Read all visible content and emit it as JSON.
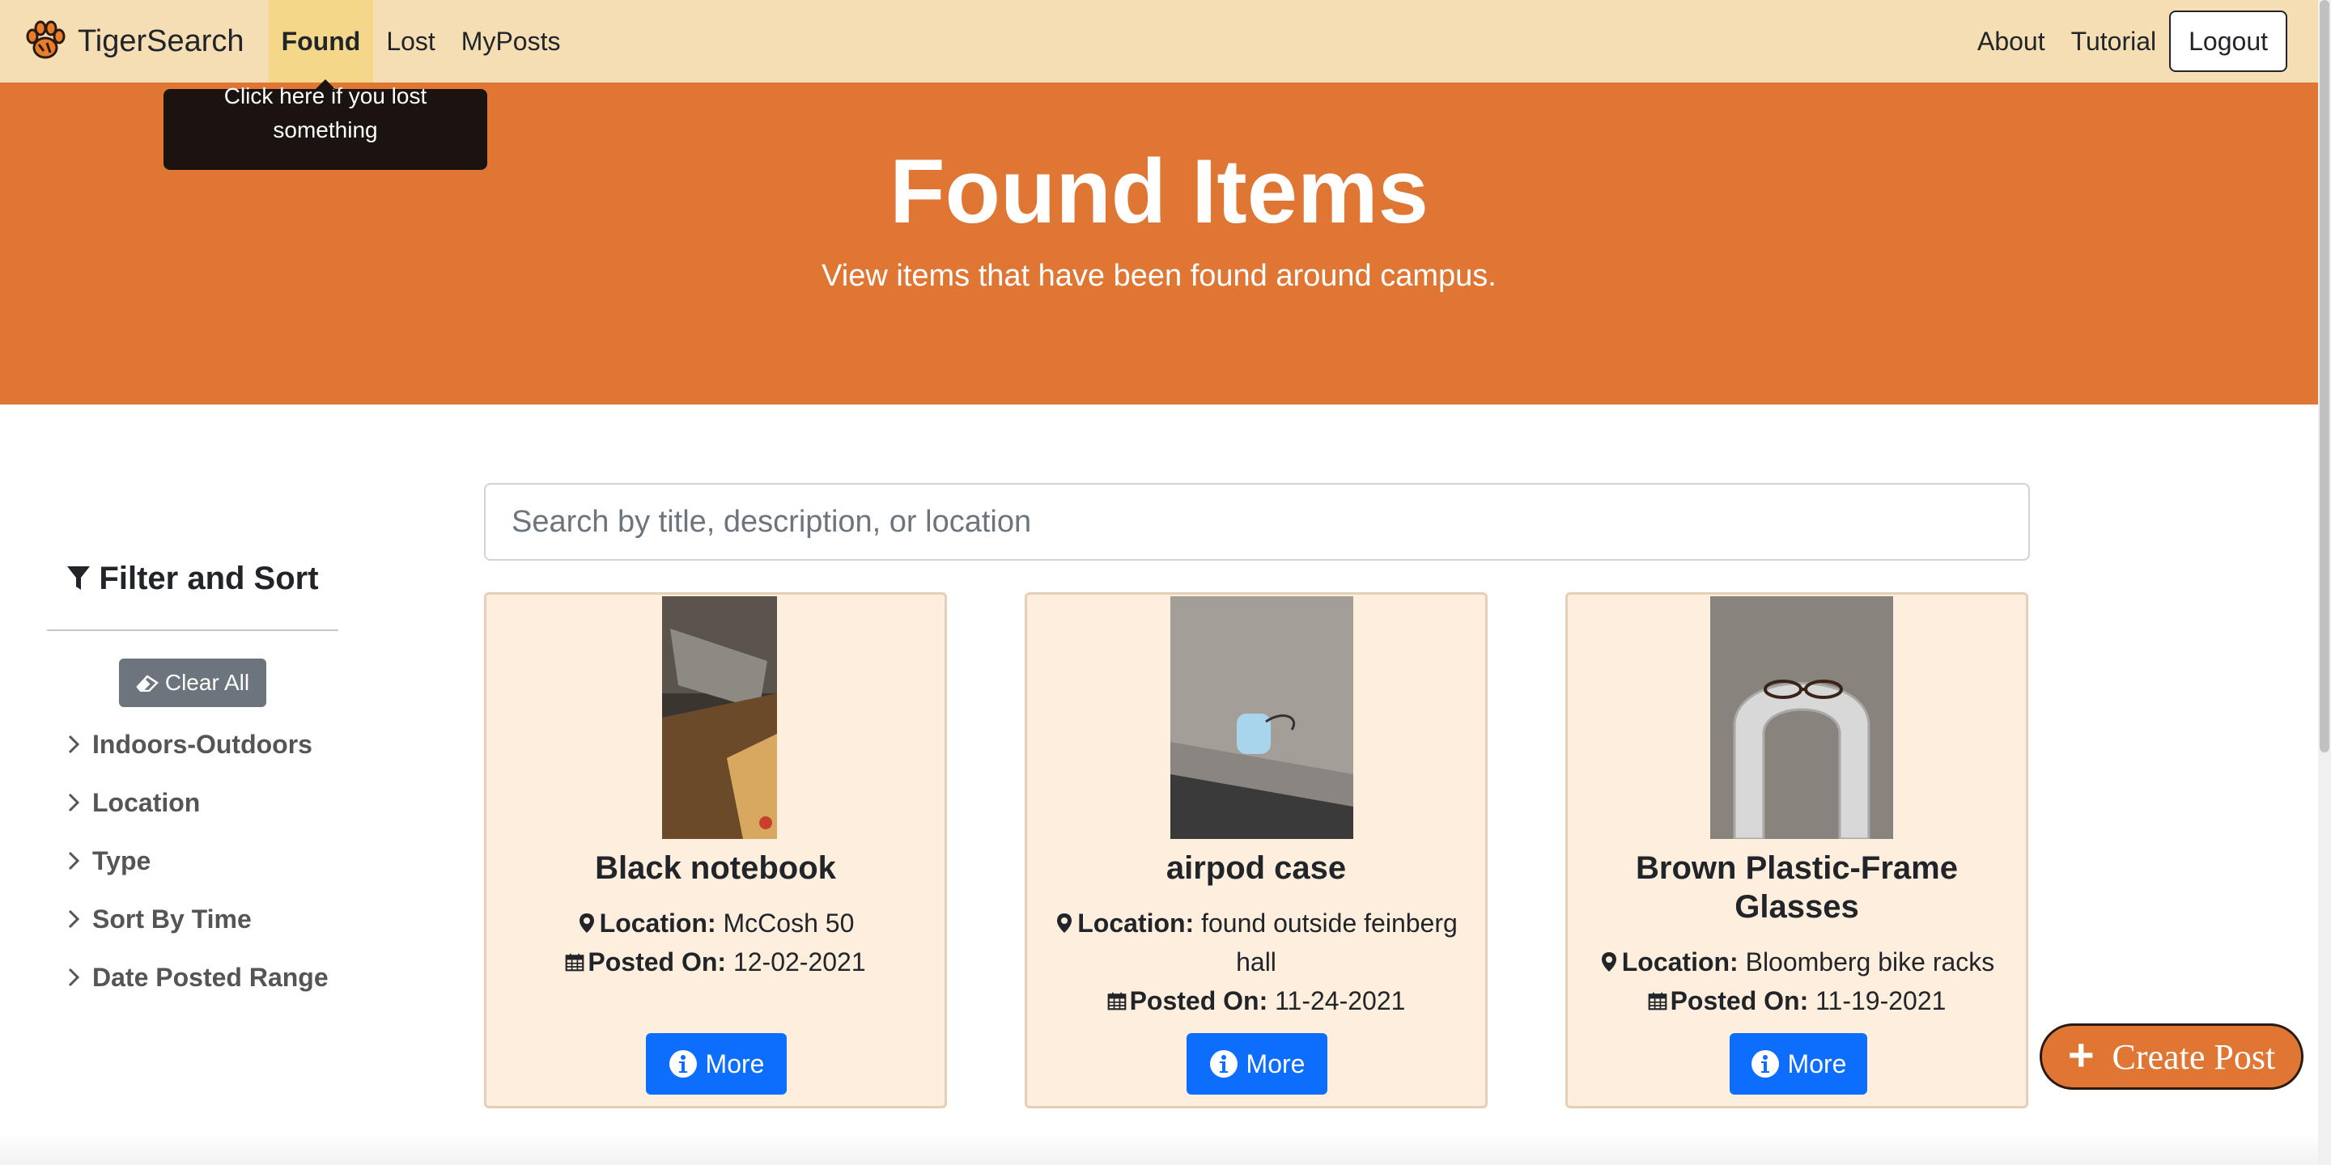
{
  "nav": {
    "brand": "TigerSearch",
    "links": [
      "Found",
      "Lost",
      "MyPosts"
    ],
    "right_links": [
      "About",
      "Tutorial"
    ],
    "logout": "Logout"
  },
  "tooltip": {
    "text": "Click here if you lost something"
  },
  "hero": {
    "title": "Found Items",
    "subtitle": "View items that have been found around campus."
  },
  "sidebar": {
    "title": "Filter and Sort",
    "clear": "Clear All",
    "filters": [
      "Indoors-Outdoors",
      "Location",
      "Type",
      "Sort By Time",
      "Date Posted Range"
    ]
  },
  "search": {
    "placeholder": "Search by title, description, or location"
  },
  "cards": [
    {
      "title": "Black notebook",
      "location_label": "Location:",
      "location": "McCosh 50",
      "posted_label": "Posted On:",
      "posted": "12-02-2021",
      "button": "More"
    },
    {
      "title": "airpod case",
      "location_label": "Location:",
      "location": "found outside feinberg hall",
      "posted_label": "Posted On:",
      "posted": "11-24-2021",
      "button": "More"
    },
    {
      "title": "Brown Plastic-Frame Glasses",
      "location_label": "Location:",
      "location": "Bloomberg bike racks",
      "posted_label": "Posted On:",
      "posted": "11-19-2021",
      "button": "More"
    }
  ],
  "create_post": {
    "label": "Create Post"
  },
  "colors": {
    "navbar": "#f5deb3",
    "hero": "#df7634",
    "card": "#fdeedd",
    "primary": "#0d6efd",
    "secondary": "#6c757d"
  }
}
